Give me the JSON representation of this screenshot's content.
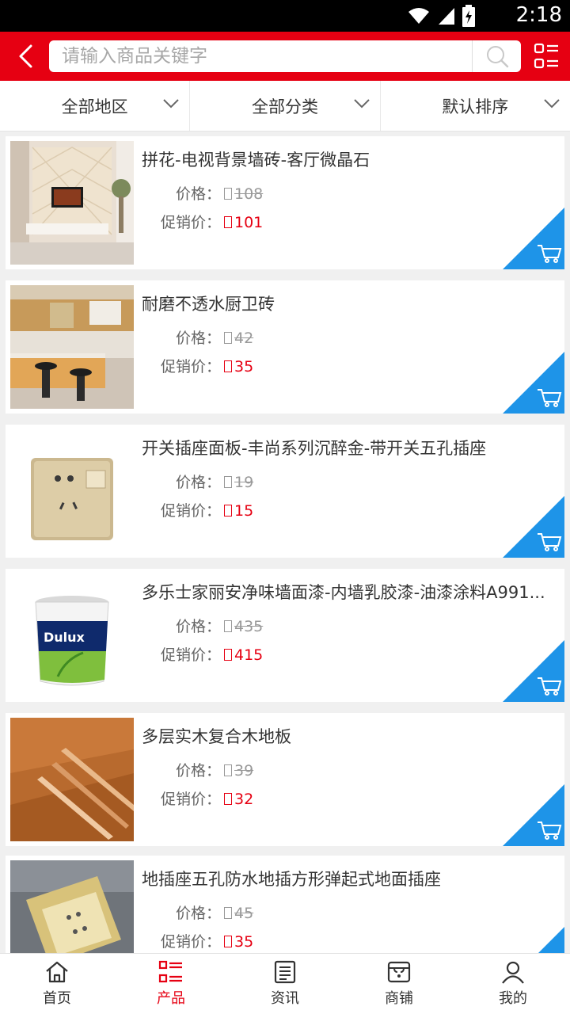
{
  "status_bar": {
    "time": "2:18",
    "icons": [
      "wifi-icon",
      "signal-icon",
      "battery-icon"
    ]
  },
  "header": {
    "search_placeholder": "请输入商品关键字",
    "accent_color": "#e60012"
  },
  "filters": [
    {
      "label": "全部地区"
    },
    {
      "label": "全部分类"
    },
    {
      "label": "默认排序"
    }
  ],
  "products": [
    {
      "title": "拼花-电视背景墙砖-客厅微晶石",
      "price_label": "价格：",
      "price": "108",
      "promo_label": "促销价：",
      "promo": "101"
    },
    {
      "title": "耐磨不透水厨卫砖",
      "price_label": "价格：",
      "price": "42",
      "promo_label": "促销价：",
      "promo": "35"
    },
    {
      "title": "开关插座面板-丰尚系列沉醉金-带开关五孔插座",
      "price_label": "价格：",
      "price": "19",
      "promo_label": "促销价：",
      "promo": "15"
    },
    {
      "title": "多乐士家丽安净味墙面漆-内墙乳胶漆-油漆涂料A991...",
      "price_label": "价格：",
      "price": "435",
      "promo_label": "促销价：",
      "promo": "415",
      "image_text": "Dulux"
    },
    {
      "title": "多层实木复合木地板",
      "price_label": "价格：",
      "price": "39",
      "promo_label": "促销价：",
      "promo": "32"
    },
    {
      "title": "地插座五孔防水地插方形弹起式地面插座",
      "price_label": "价格：",
      "price": "45",
      "promo_label": "促销价：",
      "promo": "35"
    }
  ],
  "tabbar": [
    {
      "label": "首页",
      "icon": "home-icon",
      "active": false
    },
    {
      "label": "产品",
      "icon": "product-list-icon",
      "active": true
    },
    {
      "label": "资讯",
      "icon": "news-icon",
      "active": false
    },
    {
      "label": "商铺",
      "icon": "shop-icon",
      "active": false
    },
    {
      "label": "我的",
      "icon": "user-icon",
      "active": false
    }
  ]
}
